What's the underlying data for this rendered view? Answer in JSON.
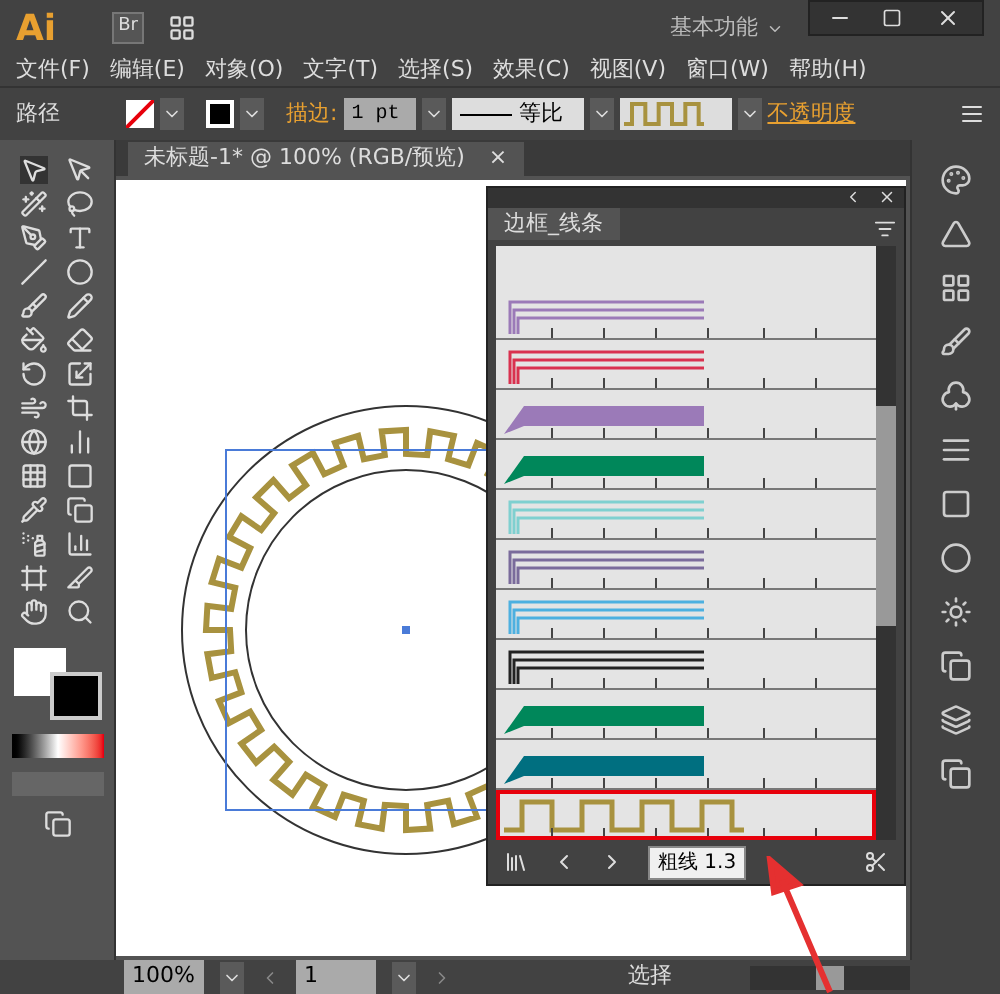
{
  "app": {
    "logo": "Ai",
    "bridge": "Br",
    "workspace": "基本功能"
  },
  "menu": [
    "文件(F)",
    "编辑(E)",
    "对象(O)",
    "文字(T)",
    "选择(S)",
    "效果(C)",
    "视图(V)",
    "窗口(W)",
    "帮助(H)"
  ],
  "control_bar": {
    "object_type": "路径",
    "stroke_label": "描边:",
    "stroke_weight": "1 pt",
    "profile": "等比",
    "opacity_label": "不透明度"
  },
  "document_tab": {
    "title": "未标题-1* @ 100% (RGB/预览)",
    "close": "×"
  },
  "brush_panel": {
    "title": "边框_线条",
    "tooltip": "粗线 1.3",
    "brushes": [
      {
        "kind": "lines",
        "color": "#9b7ab8",
        "selected": false
      },
      {
        "kind": "lines",
        "color": "#d9314f",
        "selected": false
      },
      {
        "kind": "bar",
        "color": "#9b7ab8",
        "selected": false
      },
      {
        "kind": "bar",
        "color": "#00875a",
        "selected": false
      },
      {
        "kind": "lines",
        "color": "#7fd0d0",
        "selected": false
      },
      {
        "kind": "lines",
        "color": "#7a6b9b",
        "selected": false
      },
      {
        "kind": "lines",
        "color": "#4db0e0",
        "selected": false
      },
      {
        "kind": "lines",
        "color": "#222222",
        "selected": false
      },
      {
        "kind": "bar",
        "color": "#00875a",
        "selected": false
      },
      {
        "kind": "bar",
        "color": "#006f80",
        "selected": false
      },
      {
        "kind": "key",
        "color": "#a8923f",
        "selected": true
      }
    ]
  },
  "status_bar": {
    "zoom": "100%",
    "page": "1",
    "tool": "选择"
  }
}
